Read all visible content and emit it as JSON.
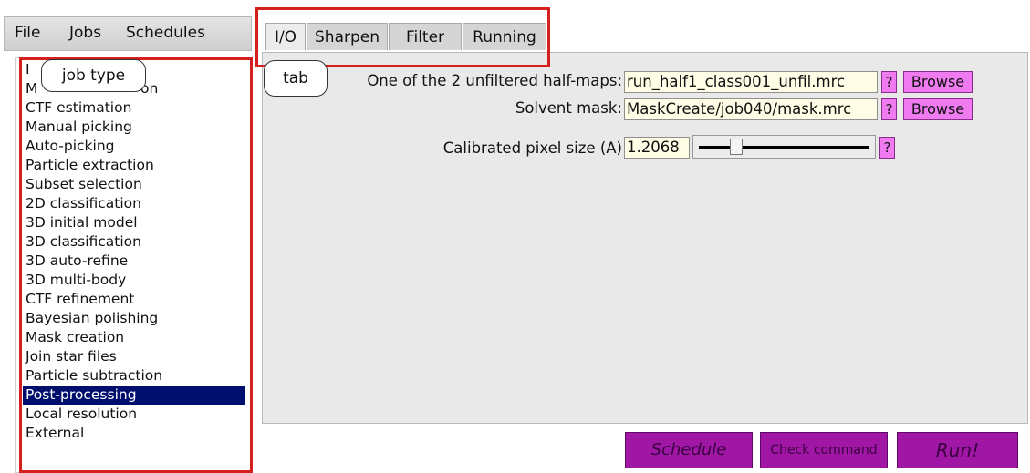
{
  "menubar": {
    "file": "File",
    "jobs": "Jobs",
    "schedules": "Schedules"
  },
  "job_types": [
    "Import",
    "Motion correction",
    "CTF estimation",
    "Manual picking",
    "Auto-picking",
    "Particle extraction",
    "Subset selection",
    "2D classification",
    "3D initial model",
    "3D classification",
    "3D auto-refine",
    "3D multi-body",
    "CTF refinement",
    "Bayesian polishing",
    "Mask creation",
    "Join star files",
    "Particle subtraction",
    "Post-processing",
    "Local resolution",
    "External"
  ],
  "job_types_visible_fragments": {
    "item0": "I",
    "item1_left": "M",
    "item1_right": "on"
  },
  "selected_job": "Post-processing",
  "tabs": {
    "io": "I/O",
    "sharpen": "Sharpen",
    "filter": "Filter",
    "running": "Running"
  },
  "active_tab": "I/O",
  "io": {
    "halfmaps_label": "One of the 2 unfiltered half-maps:",
    "halfmaps_value": "run_half1_class001_unfil.mrc",
    "mask_label": "Solvent mask:",
    "mask_value": "MaskCreate/job040/mask.mrc",
    "pixel_label": "Calibrated pixel size (A)",
    "pixel_value": "1.2068",
    "help": "?",
    "browse": "Browse"
  },
  "buttons": {
    "schedule": "Schedule",
    "check_command": "Check command",
    "run": "Run!"
  },
  "annotations": {
    "job_type": "job type",
    "tab": "tab"
  },
  "colors": {
    "annotation_red": "#d61f1f",
    "selected_bg": "#000f6e",
    "help_pink": "#f07bf0",
    "action_purple": "#a017a6",
    "field_yellow": "#fffde6"
  }
}
